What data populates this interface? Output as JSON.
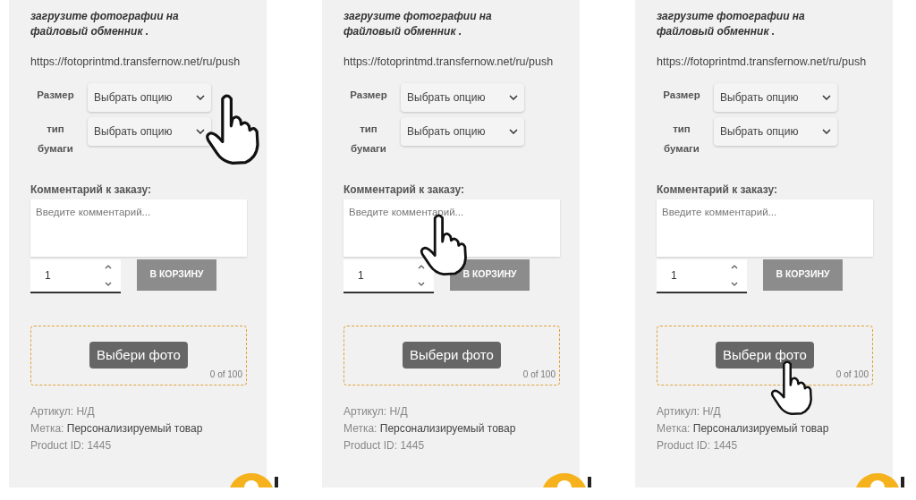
{
  "panels": [
    {
      "intro": "загрузите фотографии на файловый обменник .",
      "url": "https://fotoprintmd.transfernow.net/ru/push",
      "options": [
        {
          "label": "Размер",
          "value": "Выбрать опцию"
        },
        {
          "label": "тип бумаги",
          "value": "Выбрать опцию"
        }
      ],
      "comment_label": "Комментарий к заказу:",
      "comment_placeholder": "Введите комментарий...",
      "quantity": "1",
      "cart_button": "В КОРЗИНУ",
      "upload_button": "Выбери фото",
      "upload_count": "0 of 100",
      "meta": [
        {
          "label": "Артикул:",
          "value": "Н/Д"
        },
        {
          "label": "Метка:",
          "value": "Персонализируемый товар"
        },
        {
          "label": "Product ID:",
          "value": "1445"
        }
      ],
      "cursor": {
        "kind": "on_select"
      }
    },
    {
      "intro": "загрузите фотографии на файловый обменник .",
      "url": "https://fotoprintmd.transfernow.net/ru/push",
      "options": [
        {
          "label": "Размер",
          "value": "Выбрать опцию"
        },
        {
          "label": "тип бумаги",
          "value": "Выбрать опцию"
        }
      ],
      "comment_label": "Комментарий к заказу:",
      "comment_placeholder": "Введите комментарий...",
      "quantity": "1",
      "cart_button": "В КОРЗИНУ",
      "upload_button": "Выбери фото",
      "upload_count": "0 of 100",
      "meta": [
        {
          "label": "Артикул:",
          "value": "Н/Д"
        },
        {
          "label": "Метка:",
          "value": "Персонализируемый товар"
        },
        {
          "label": "Product ID:",
          "value": "1445"
        }
      ],
      "cursor": {
        "kind": "on_comment"
      }
    },
    {
      "intro": "загрузите фотографии на файловый обменник .",
      "url": "https://fotoprintmd.transfernow.net/ru/push",
      "options": [
        {
          "label": "Размер",
          "value": "Выбрать опцию"
        },
        {
          "label": "тип бумаги",
          "value": "Выбрать опцию"
        }
      ],
      "comment_label": "Комментарий к заказу:",
      "comment_placeholder": "Введите комментарий...",
      "quantity": "1",
      "cart_button": "В КОРЗИНУ",
      "upload_button": "Выбери фото",
      "upload_count": "0 of 100",
      "meta": [
        {
          "label": "Артикул:",
          "value": "Н/Д"
        },
        {
          "label": "Метка:",
          "value": "Персонализируемый товар"
        },
        {
          "label": "Product ID:",
          "value": "1445"
        }
      ],
      "cursor": {
        "kind": "on_upload"
      }
    }
  ]
}
